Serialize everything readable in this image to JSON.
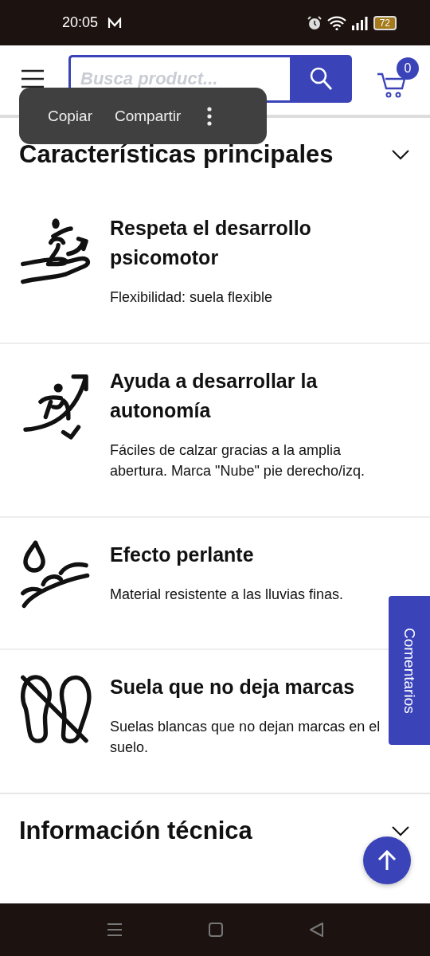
{
  "status_bar": {
    "time": "20:05",
    "battery": "72"
  },
  "header": {
    "search": {
      "placeholder": "Busca product..."
    },
    "cart_count": "0"
  },
  "context_menu": {
    "items": [
      "Copiar",
      "Compartir"
    ]
  },
  "sections": [
    {
      "title": "Características principales",
      "features": [
        {
          "title": "Respeta el desarrollo psicomotor",
          "description": "Flexibilidad: suela flexible"
        },
        {
          "title": "Ayuda a desarrollar la autonomía",
          "description": "Fáciles de calzar gracias a la amplia abertura. Marca \"Nube\" pie derecho/izq."
        },
        {
          "title": "Efecto perlante",
          "description": "Material resistente a las lluvias finas."
        },
        {
          "title": "Suela que no deja marcas",
          "description": "Suelas blancas que no dejan marcas en el suelo."
        }
      ]
    },
    {
      "title": "Información técnica"
    }
  ],
  "side_tab": {
    "label": "Comentarios"
  }
}
